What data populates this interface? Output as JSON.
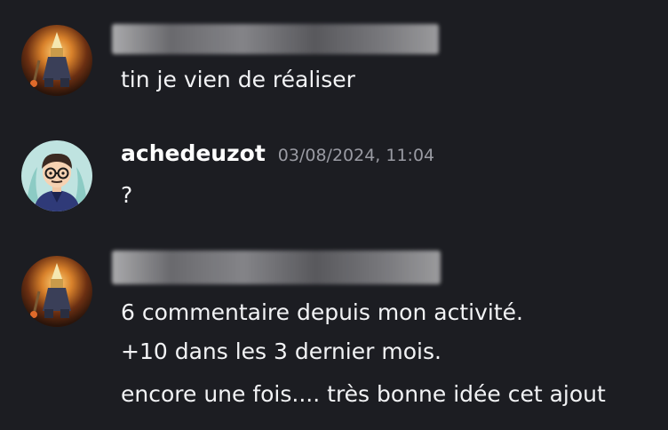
{
  "messages": [
    {
      "author": "",
      "author_redacted": true,
      "avatar_icon": "orange-fantasy-character-avatar-icon",
      "lines": [
        "tin je vien de réaliser"
      ]
    },
    {
      "author": "achedeuzot",
      "timestamp": "03/08/2024, 11:04",
      "avatar_icon": "cartoon-glasses-person-avatar-icon",
      "lines": [
        "?"
      ]
    },
    {
      "author": "",
      "author_redacted": true,
      "avatar_icon": "orange-fantasy-character-avatar-icon",
      "lines": [
        "6 commentaire depuis mon activité.",
        "+10 dans les 3 dernier mois.",
        "encore une fois.... très bonne idée cet ajout"
      ]
    }
  ],
  "colors": {
    "background": "#1c1d22",
    "text": "#f2f3f5",
    "timestamp": "#9a9ba3"
  }
}
